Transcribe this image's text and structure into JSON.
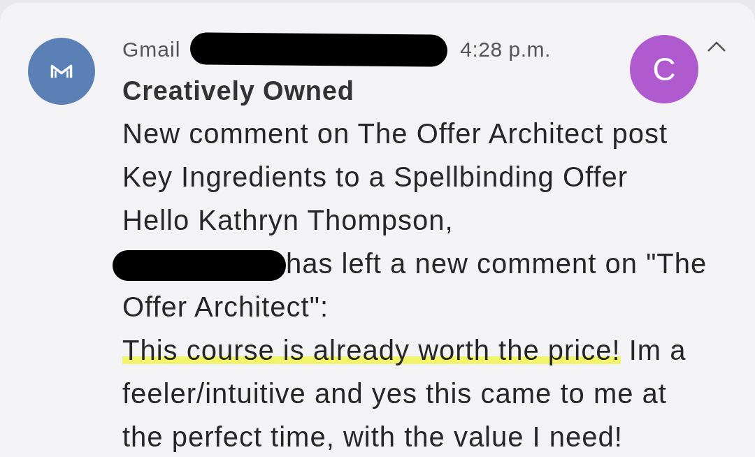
{
  "notification": {
    "app": "Gmail",
    "sender_redacted": true,
    "time": "4:28 p.m.",
    "expanded": true,
    "title": "Creatively Owned",
    "avatar_letter": "C",
    "lines": [
      [
        {
          "kind": "text",
          "text": "New comment on The Offer Architect post",
          "highlighted": false
        }
      ],
      [
        {
          "kind": "text",
          "text": "Key Ingredients to a Spellbinding Offer",
          "highlighted": false
        }
      ],
      [
        {
          "kind": "text",
          "text": "Hello Kathryn Thompson,",
          "highlighted": false
        }
      ],
      [
        {
          "kind": "redaction"
        },
        {
          "kind": "text",
          "text": "has left a new comment on \"The",
          "highlighted": false
        }
      ],
      [
        {
          "kind": "text",
          "text": "Offer Architect\":",
          "highlighted": false
        }
      ],
      [
        {
          "kind": "text",
          "text": "This course is already worth the price!",
          "highlighted": true
        },
        {
          "kind": "text",
          "text": " Im a",
          "highlighted": false
        }
      ],
      [
        {
          "kind": "text",
          "text": "feeler/intuitive and yes this came to me at",
          "highlighted": false
        }
      ],
      [
        {
          "kind": "text",
          "text": "the perfect time, with the value I need!",
          "highlighted": false
        }
      ]
    ]
  }
}
